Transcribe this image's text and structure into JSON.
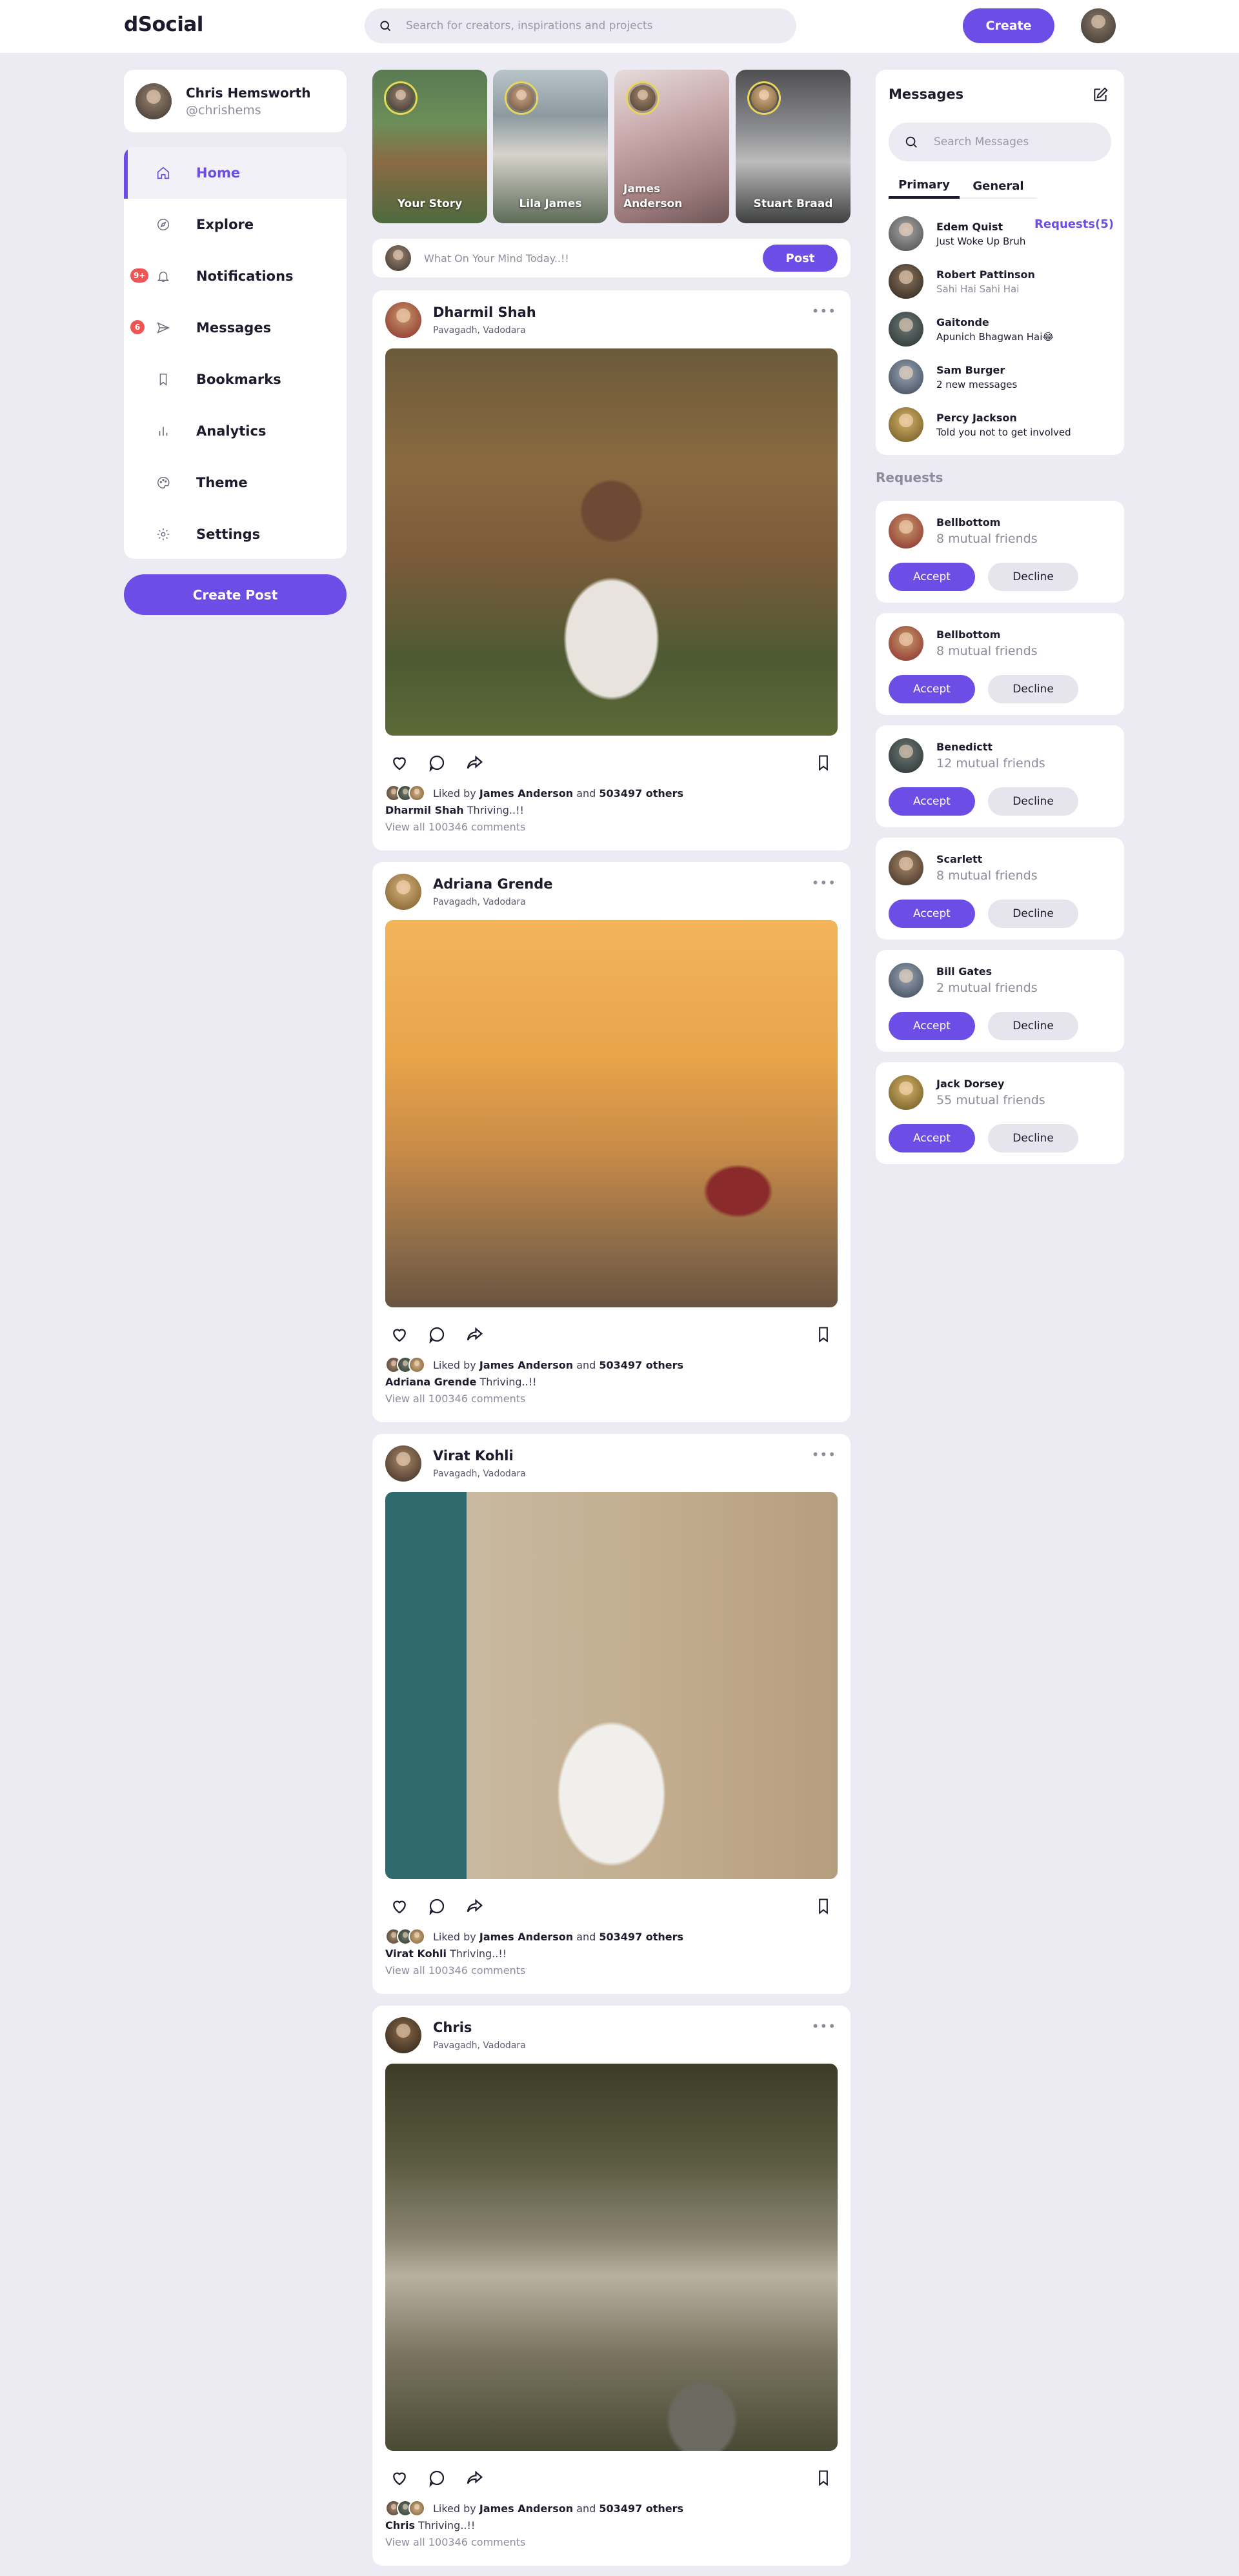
{
  "header": {
    "logo": "dSocial",
    "search_placeholder": "Search for creators, inspirations and projects",
    "create_label": "Create"
  },
  "profile": {
    "name": "Chris Hemsworth",
    "handle": "@chrishems"
  },
  "nav": [
    {
      "label": "Home",
      "icon": "home-icon",
      "active": true
    },
    {
      "label": "Explore",
      "icon": "compass-icon"
    },
    {
      "label": "Notifications",
      "icon": "bell-icon",
      "badge": "9+"
    },
    {
      "label": "Messages",
      "icon": "send-icon",
      "badge": "6"
    },
    {
      "label": "Bookmarks",
      "icon": "bookmark-icon"
    },
    {
      "label": "Analytics",
      "icon": "bar-chart-icon"
    },
    {
      "label": "Theme",
      "icon": "palette-icon"
    },
    {
      "label": "Settings",
      "icon": "gear-icon"
    }
  ],
  "create_post_label": "Create Post",
  "stories": [
    {
      "name": "Your Story"
    },
    {
      "name": "Lila James"
    },
    {
      "name": "James Anderson"
    },
    {
      "name": "Stuart Braad"
    }
  ],
  "composer": {
    "placeholder": "What On Your Mind Today..!!",
    "post_label": "Post"
  },
  "posts": [
    {
      "author": "Dharmil Shah",
      "location": "Pavagadh, Vadodara",
      "liked_by": "James Anderson",
      "likes_others": "503497 others",
      "caption": "Thriving..!!",
      "comments": "View all 100346 comments"
    },
    {
      "author": "Adriana Grende",
      "location": "Pavagadh, Vadodara",
      "liked_by": "James Anderson",
      "likes_others": "503497 others",
      "caption": "Thriving..!!",
      "comments": "View all 100346 comments"
    },
    {
      "author": "Virat Kohli",
      "location": "Pavagadh, Vadodara",
      "liked_by": "James Anderson",
      "likes_others": "503497 others",
      "caption": "Thriving..!!",
      "comments": "View all 100346 comments"
    },
    {
      "author": "Chris",
      "location": "Pavagadh, Vadodara",
      "liked_by": "James Anderson",
      "likes_others": "503497 others",
      "caption": "Thriving..!!",
      "comments": "View all 100346 comments"
    }
  ],
  "liked_connector": "Liked by",
  "liked_and": "and",
  "messages": {
    "title": "Messages",
    "search_placeholder": "Search Messages",
    "tabs": [
      "Primary",
      "General",
      "Requests(5)"
    ],
    "threads": [
      {
        "name": "Edem Quist",
        "text": "Just Woke Up Bruh"
      },
      {
        "name": "Robert Pattinson",
        "text": "Sahi Hai Sahi Hai"
      },
      {
        "name": "Gaitonde",
        "text": "Apunich Bhagwan Hai😂"
      },
      {
        "name": "Sam Burger",
        "text": "2 new messages"
      },
      {
        "name": "Percy Jackson",
        "text": "Told you not to get involved"
      }
    ]
  },
  "requests": {
    "title": "Requests",
    "accept_label": "Accept",
    "decline_label": "Decline",
    "items": [
      {
        "name": "Bellbottom",
        "mutual": "8 mutual friends"
      },
      {
        "name": "Bellbottom",
        "mutual": "8 mutual friends"
      },
      {
        "name": "Benedictt",
        "mutual": "12 mutual friends"
      },
      {
        "name": "Scarlett",
        "mutual": "8 mutual friends"
      },
      {
        "name": "Bill Gates",
        "mutual": "2 mutual friends"
      },
      {
        "name": "Jack Dorsey",
        "mutual": "55 mutual friends"
      }
    ]
  },
  "colors": {
    "accent": "#6c4ee6",
    "badge": "#f05454",
    "background": "#eceaf3"
  }
}
